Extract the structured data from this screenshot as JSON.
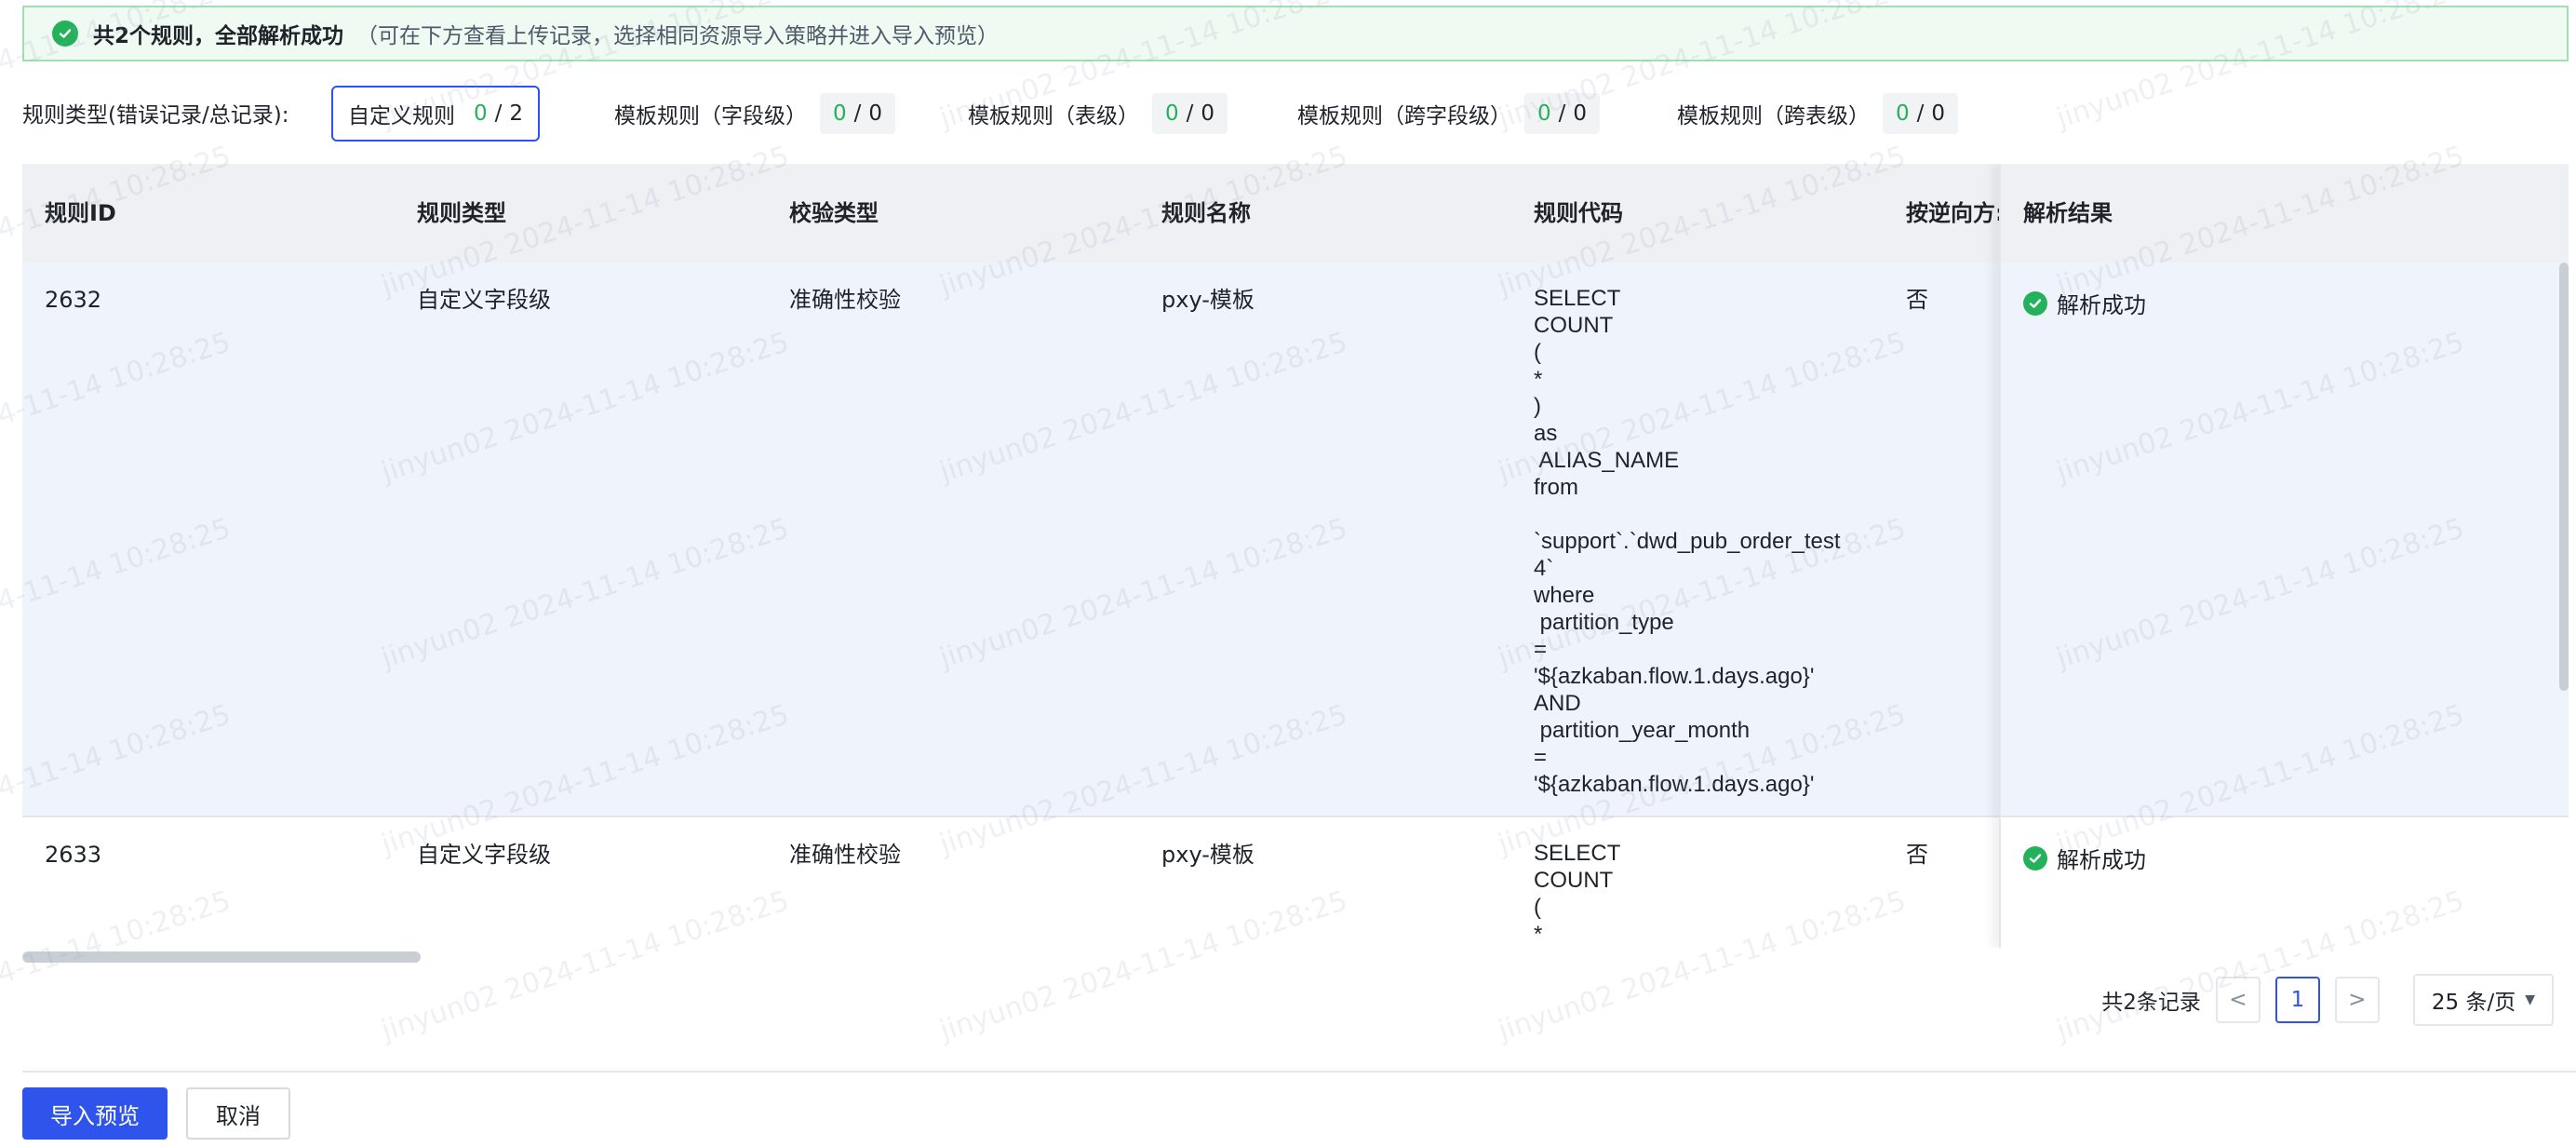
{
  "banner": {
    "title": "共2个规则，全部解析成功",
    "hint": "（可在下方查看上传记录，选择相同资源导入策略并进入导入预览）"
  },
  "filters": {
    "label": "规则类型(错误记录/总记录):",
    "chips": [
      {
        "label": "自定义规则",
        "error": "0",
        "total": "2"
      },
      {
        "label": "模板规则（字段级）",
        "error": "0",
        "total": "0"
      },
      {
        "label": "模板规则（表级）",
        "error": "0",
        "total": "0"
      },
      {
        "label": "模板规则（跨字段级）",
        "error": "0",
        "total": "0"
      },
      {
        "label": "模板规则（跨表级）",
        "error": "0",
        "total": "0"
      }
    ],
    "sep": "/"
  },
  "table": {
    "columns": [
      "规则ID",
      "规则类型",
      "校验类型",
      "规则名称",
      "规则代码",
      "按逆向方:",
      "解析结果"
    ],
    "rows": [
      {
        "id": "2632",
        "rule_type": "自定义字段级",
        "check_type": "准确性校验",
        "name": "pxy-模板",
        "code": [
          "SELECT",
          "COUNT",
          "(",
          "*",
          ")",
          "as",
          " ALIAS_NAME",
          "from",
          "",
          "`support`.`dwd_pub_order_test",
          "4`",
          "where",
          " partition_type",
          "=",
          "'${azkaban.flow.1.days.ago}'",
          "AND",
          " partition_year_month",
          "=",
          "'${azkaban.flow.1.days.ago}'"
        ],
        "reverse": "否",
        "result": "解析成功"
      },
      {
        "id": "2633",
        "rule_type": "自定义字段级",
        "check_type": "准确性校验",
        "name": "pxy-模板",
        "code": [
          "SELECT",
          "COUNT",
          "(",
          "*",
          "`"
        ],
        "reverse": "否",
        "result": "解析成功"
      }
    ]
  },
  "pagination": {
    "total_text": "共2条记录",
    "prev": "<",
    "current": "1",
    "next": ">",
    "page_size": "25 条/页"
  },
  "actions": {
    "primary": "导入预览",
    "cancel": "取消"
  },
  "watermark": "jinyun02 2024-11-14 10:28:25",
  "colors": {
    "accent": "#2f54eb",
    "success": "#23b25b"
  }
}
